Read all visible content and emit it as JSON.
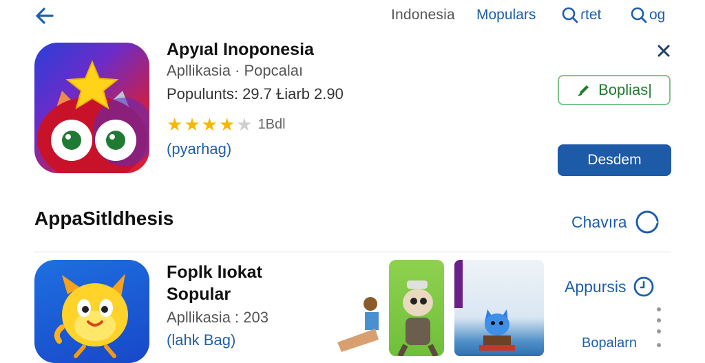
{
  "header": {
    "nav": [
      "Indonesia",
      "Mopulars",
      "ɾtet",
      "og"
    ]
  },
  "featured": {
    "title": "Apyıal Inoponesia",
    "subtitle": "Apllikasia · Popcalaı",
    "populants": "Populunts: 29.7 Ɫiarb 2.90",
    "rating_value": 4,
    "rating_count": "1Bdl",
    "link": "(pyarhag)",
    "outline_button": "Boplias|",
    "primary_button": "Desdem"
  },
  "section": {
    "title": "AppaSitldhesis",
    "action": "Chavıra"
  },
  "second": {
    "title_line1": "Foplk lıokat",
    "title_line2": "Sopular",
    "subtitle": "Apllikasia : 203",
    "link": "(lahk Bag)",
    "side_action": "Appursis",
    "side_secondary": "Bopalarn"
  },
  "colors": {
    "accent_blue": "#1c5fae",
    "primary_button": "#1d5aa8",
    "outline_green": "#7fc48a",
    "star": "#f6b800"
  },
  "icons": [
    "back-arrow-icon",
    "search-icon",
    "close-icon",
    "edit-icon",
    "chevron-circle-icon",
    "clock-icon",
    "more-vert-icon"
  ]
}
